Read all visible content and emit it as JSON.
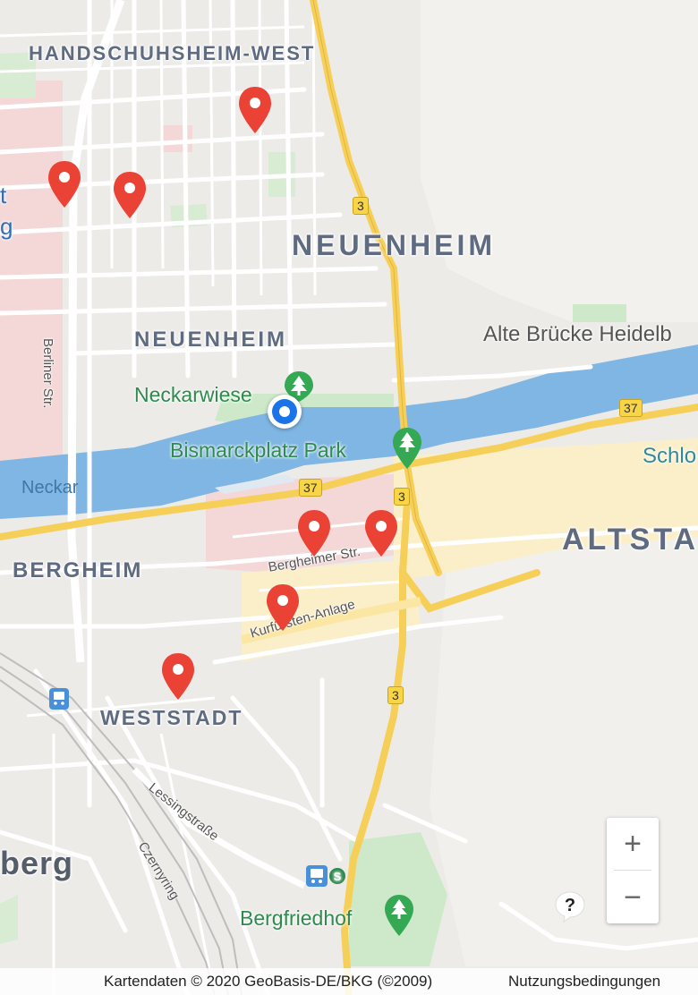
{
  "districts": {
    "handschuhsheim_west": "HANDSCHUHSHEIM-WEST",
    "neuenheim_large": "NEUENHEIM",
    "neuenheim_small": "NEUENHEIM",
    "bergheim": "BERGHEIM",
    "weststadt": "WESTSTADT",
    "altstadt_partial": "ALTSTA",
    "left_edge_partial": "berg"
  },
  "places": {
    "neckarwiese": "Neckarwiese",
    "bismarckplatz_park": "Bismarckplatz Park",
    "bergfriedhof": "Bergfriedhof",
    "alte_bruecke": "Alte Brücke Heidelb",
    "schloss_partial": "Schlo",
    "neckar": "Neckar",
    "left_edge_t": "t",
    "left_edge_g": "g"
  },
  "streets": {
    "berliner_str": "Berliner Str.",
    "bergheimer_str": "Bergheimer Str.",
    "kurfuersten_anlage": "Kurfürsten-Anlage",
    "lessingstrasse": "Lessingstraße",
    "czernyring": "Czernyring"
  },
  "road_shields": {
    "b3_north": "3",
    "b3_center": "3",
    "b3_south": "3",
    "b37_east": "37",
    "b37_center": "37"
  },
  "markers": [
    {
      "id": "marker-1",
      "color": "#ea4335"
    },
    {
      "id": "marker-2",
      "color": "#ea4335"
    },
    {
      "id": "marker-3",
      "color": "#ea4335"
    },
    {
      "id": "marker-4",
      "color": "#ea4335"
    },
    {
      "id": "marker-5",
      "color": "#ea4335"
    },
    {
      "id": "marker-6",
      "color": "#ea4335"
    },
    {
      "id": "marker-7",
      "color": "#ea4335"
    }
  ],
  "controls": {
    "zoom_in": "+",
    "zoom_out": "−",
    "help": "?"
  },
  "attribution": {
    "map_data": "Kartendaten © 2020 GeoBasis-DE/BKG (©2009)",
    "terms": "Nutzungsbedingungen"
  },
  "colors": {
    "land": "#ecebe8",
    "water": "#7fb6e3",
    "park": "#cde9c9",
    "road_major": "#f6cf59",
    "road_minor": "#ffffff",
    "urban_pink": "#f4d8d8",
    "urban_yellow": "#fbefc9",
    "marker": "#ea4335",
    "location": "#1a73e8"
  },
  "icons": {
    "park": "tree-icon",
    "train": "train-station-icon",
    "s_bahn": "s-bahn-icon",
    "marker": "map-pin-icon",
    "location": "current-location-icon"
  }
}
